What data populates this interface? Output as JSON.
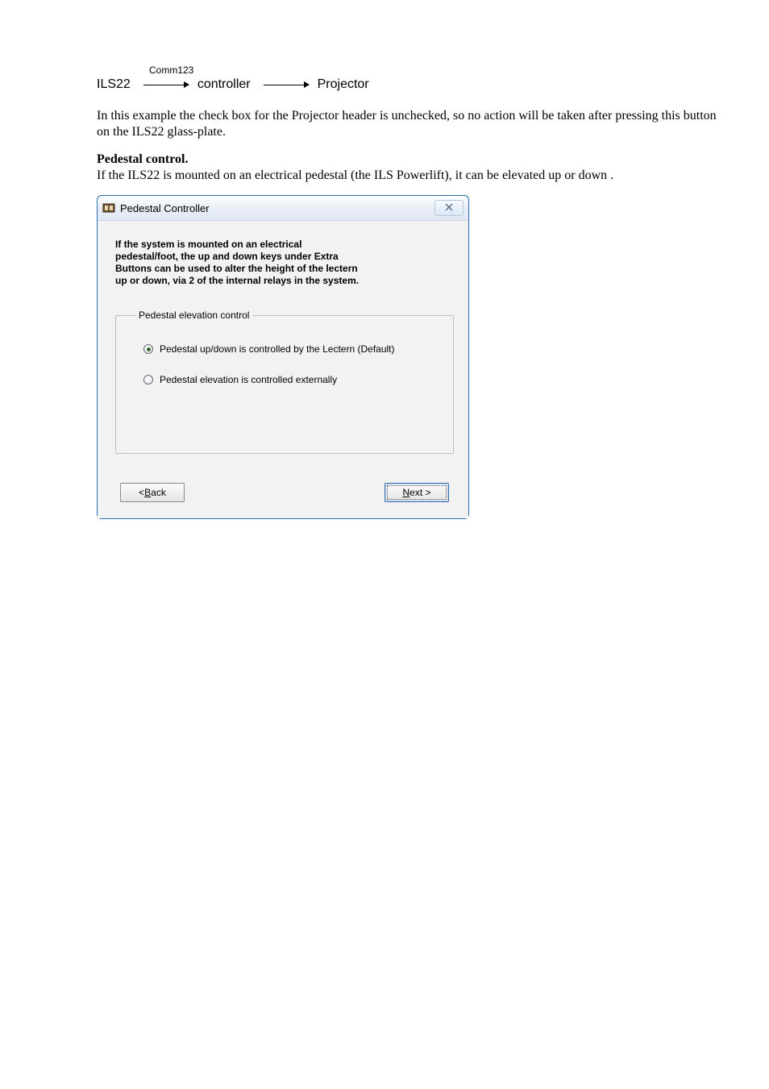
{
  "flow": {
    "comm_label": "Comm123",
    "node1": "ILS22",
    "node2": "controller",
    "node3": "Projector"
  },
  "paragraphs": {
    "p1": "In this example the check box for the Projector header is unchecked, so no action will be taken after pressing this button on the ILS22 glass-plate.",
    "h1": "Pedestal control.",
    "p2": "If the ILS22 is mounted on an electrical pedestal (the ILS Powerlift), it can be elevated up or down ."
  },
  "dialog": {
    "title": "Pedestal Controller",
    "info_line1": "If the system is mounted on an electrical",
    "info_line2": "pedestal/foot, the up and down keys under Extra",
    "info_line3": "Buttons can be used to alter the height of the lectern",
    "info_line4": "up or down, via 2 of the internal relays in the system.",
    "group_legend": "Pedestal elevation control",
    "radio1_label": "Pedestal up/down is controlled by the Lectern (Default)",
    "radio2_label": "Pedestal elevation is controlled externally",
    "radio_selected": 1,
    "back_prefix": "< ",
    "back_mnemonic": "B",
    "back_suffix": "ack",
    "next_mnemonic": "N",
    "next_suffix": "ext >"
  }
}
